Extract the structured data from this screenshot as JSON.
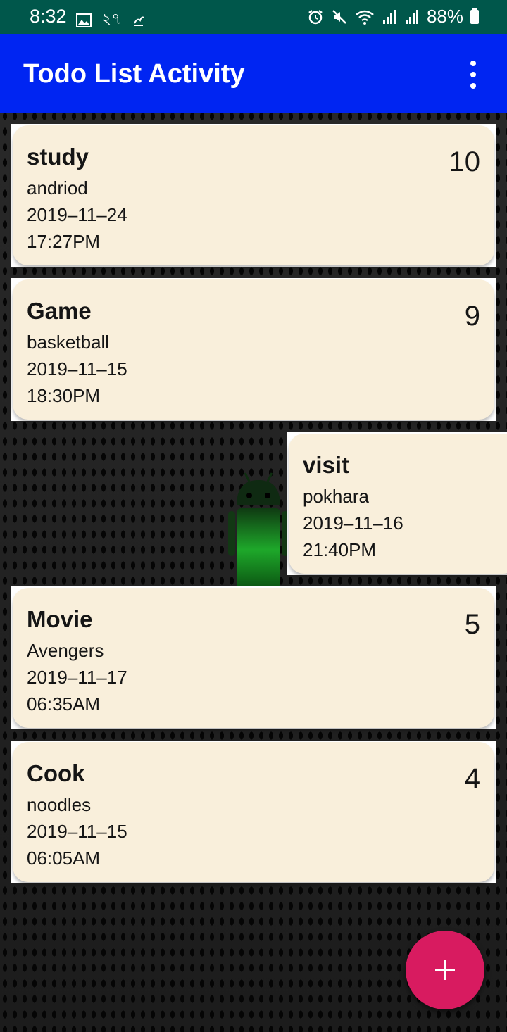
{
  "status_bar": {
    "time": "8:32",
    "left_icons": [
      "image-icon",
      "notification-text-icon",
      "notification-app-icon"
    ],
    "left_text": "২৭",
    "battery_percent": "88%",
    "right_icons": [
      "alarm-icon",
      "mute-icon",
      "wifi-icon",
      "signal-icon",
      "signal-icon",
      "battery-icon"
    ]
  },
  "app_bar": {
    "title": "Todo List Activity",
    "menu_icon": "overflow-menu-icon",
    "color": "#0025f2"
  },
  "todos": [
    {
      "title": "study",
      "description": "andriod",
      "date": "2019–11–24",
      "time": "17:27PM",
      "priority": "10"
    },
    {
      "title": "Game",
      "description": "basketball",
      "date": "2019–11–15",
      "time": "18:30PM",
      "priority": "9"
    },
    {
      "title": "visit",
      "description": "pokhara",
      "date": "2019–11–16",
      "time": "21:40PM",
      "priority": ""
    },
    {
      "title": "Movie",
      "description": "Avengers",
      "date": "2019–11–17",
      "time": "06:35AM",
      "priority": "5"
    },
    {
      "title": "Cook",
      "description": "noodles",
      "date": "2019–11–15",
      "time": "06:05AM",
      "priority": "4"
    }
  ],
  "fab": {
    "icon": "plus-icon",
    "color": "#d81b60"
  },
  "colors": {
    "status_bar": "#00574b",
    "card_background": "#f9efdb"
  }
}
